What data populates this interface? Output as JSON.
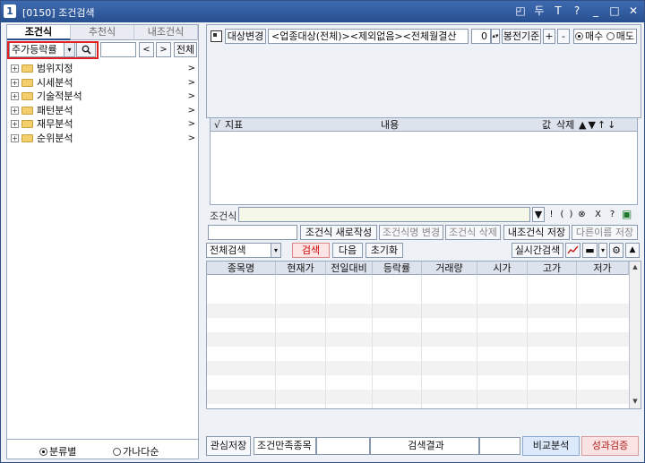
{
  "window": {
    "number": "1",
    "title": "[0150] 조건검색",
    "icons": [
      "◰",
      "두",
      "T",
      "?",
      "_",
      "□",
      "✕"
    ]
  },
  "left_panel": {
    "tabs": [
      "조건식",
      "추천식",
      "내조건식"
    ],
    "combo_value": "주가등락률",
    "combo_arrow": "▾",
    "nav_prev": "<",
    "nav_next": ">",
    "all_label": "전체",
    "tree_items": [
      "범위지정",
      "시세분석",
      "기술적분석",
      "패턴분석",
      "재무분석",
      "순위분석"
    ],
    "plus": "+",
    "chevron": ">",
    "radio_by_category": "분류별",
    "radio_alpha": "가나다순"
  },
  "target": {
    "change_label": "대상변경",
    "filter_value": "<업종대상(전체)><제외없음><전체월결산",
    "count_value": "0",
    "months_label": "봉전기준",
    "plus": "+",
    "minus": "-",
    "buy_label": "매수",
    "sell_label": "매도"
  },
  "indicator_table": {
    "check_col": "√",
    "col_indicator": "지표",
    "col_content": "내용",
    "col_value": "값",
    "col_delete": "삭제",
    "col_arrows": "▲▼↑↓"
  },
  "condition": {
    "label": "조건식",
    "symbols": [
      "▼",
      "!",
      "(",
      ")",
      "⊗",
      "X",
      "?",
      "▣"
    ]
  },
  "actions": {
    "new_write": "조건식 새로작성",
    "rename": "조건식명 변경",
    "delete": "조건식 삭제",
    "save_mine": "내조건식 저장",
    "save_as": "다른이름 저장"
  },
  "results": {
    "scope_value": "전체검색",
    "search": "검색",
    "next": "다음",
    "reset": "초기화",
    "realtime": "실시간검색",
    "columns": [
      "종목명",
      "현재가",
      "전일대비",
      "등락률",
      "거래량",
      "시가",
      "고가",
      "저가"
    ]
  },
  "bottom": {
    "watch_save": "관심저장",
    "satisfied": "조건만족종목",
    "search_result": "검색결과",
    "compare": "비교분석",
    "verify": "성과검증"
  }
}
